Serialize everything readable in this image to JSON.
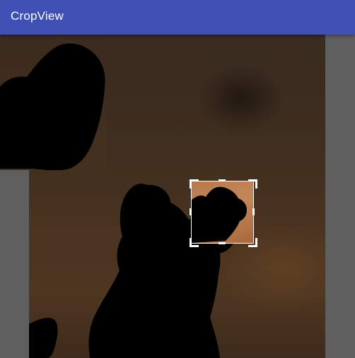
{
  "toolbar": {
    "title": "CropView",
    "color": "#3f51b5",
    "title_color": "#ffffff"
  },
  "crop_view": {
    "image_subject": "silhouette-photo",
    "background_color": "#5f5f5f",
    "frame_color": "#ffffff"
  },
  "icons": {
    "crop_handle": "crop-handle-icon"
  }
}
